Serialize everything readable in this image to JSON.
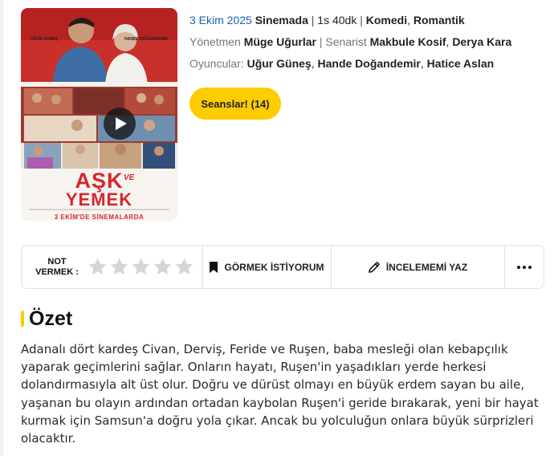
{
  "poster": {
    "title_line1": "AŞK",
    "title_ve": "VE",
    "title_line2": "YEMEK",
    "release_text": "3 EKİM'DE SİNEMALARDA",
    "actor_left": "UĞUR GÜNEŞ",
    "actor_right": "HANDE DOĞANDEMİR"
  },
  "meta": {
    "date": "3 Ekim 2025",
    "status": "Sinemada",
    "duration": "1s 40dk",
    "genre1": "Komedi",
    "genre2": "Romantik",
    "director_label": "Yönetmen",
    "director": "Müge Uğurlar",
    "writer_label": "Senarist",
    "writer1": "Makbule Kosif",
    "writer2": "Derya Kara",
    "cast_label": "Oyuncular:",
    "cast1": "Uğur Güneş",
    "cast2": "Hande Doğandemir",
    "cast3": "Hatice Aslan"
  },
  "sessions_button": "Seanslar! (14)",
  "actions": {
    "rate_line1": "NOT",
    "rate_line2": "VERMEK :",
    "rating_stars": 0,
    "star_count": 5,
    "watch_label": "GÖRMEK İSTİYORUM",
    "review_label": "İNCELEMEMİ YAZ"
  },
  "summary": {
    "heading": "Özet",
    "text": "Adanalı dört kardeş Civan, Derviş, Feride ve Ruşen, baba mesleği olan kebapçılık yaparak geçimlerini sağlar. Onların hayatı, Ruşen'in yaşadıkları yerde herkesi dolandırmasıyla alt üst olur. Doğru ve dürüst olmayı en büyük erdem sayan bu aile, yaşanan bu olayın ardından ortadan kaybolan Ruşen'i geride bırakarak, yeni bir hayat kurmak için Samsun'a doğru yola çıkar. Ancak bu yolculuğun onlara büyük sürprizleri olacaktır."
  },
  "colors": {
    "accent": "#ffcc00",
    "link": "#1c5fb0",
    "poster_red": "#d8262c",
    "star_empty": "#d6d6d6"
  }
}
